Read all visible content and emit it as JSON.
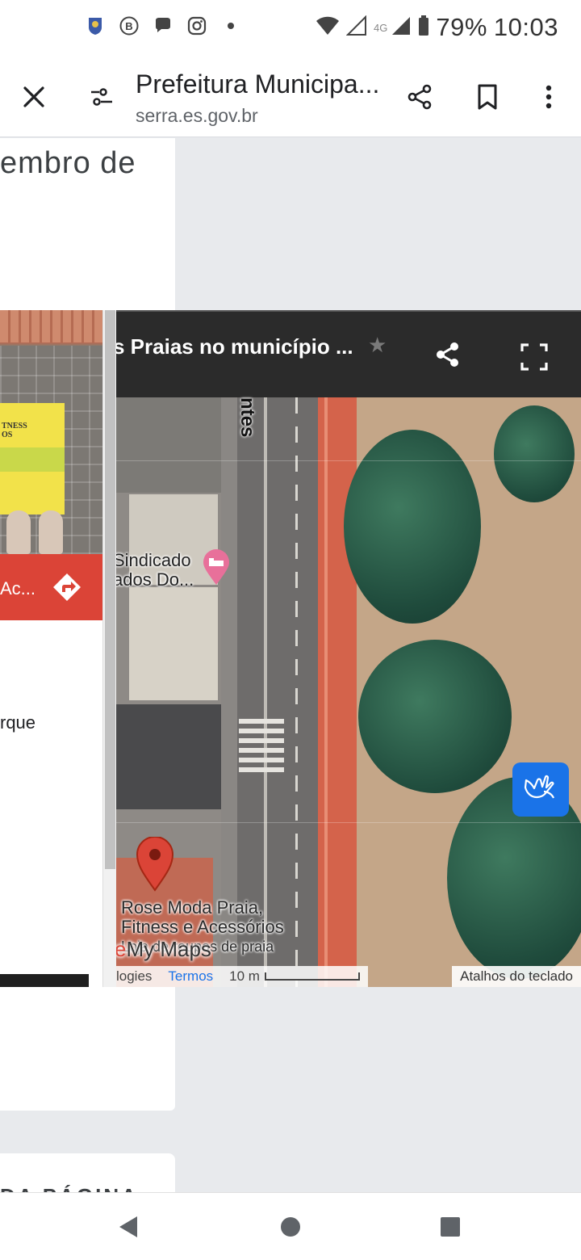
{
  "status_bar": {
    "battery": "79%",
    "time": "10:03",
    "network": "4G",
    "icons": [
      "app-badge-icon",
      "b-circle-icon",
      "chat-bubble-icon",
      "instagram-icon",
      "dot-icon",
      "wifi-icon",
      "signal-empty-icon",
      "signal-full-icon",
      "battery-icon"
    ]
  },
  "toolbar": {
    "title": "Prefeitura Municipa...",
    "url": "serra.es.gov.br"
  },
  "page": {
    "snippet_top": "embro de",
    "address_fragment": "rque",
    "heading_fragment": "DA PÁGINA"
  },
  "left_panel": {
    "banner_text": "TNESS\nOS",
    "route_label": "Ac..."
  },
  "map": {
    "title": "s Praias no município ...",
    "street_label": "ntes",
    "poi": "Sindicado\nados Do...",
    "marker_name_1": "Rose Moda Praia,",
    "marker_name_2": "Fitness e Acessórios",
    "marker_category": "Loja de roupas de praia",
    "logo_accent": "e",
    "logo_text": "My Maps",
    "attribution": "logies",
    "terms": "Termos",
    "scale": "10 m",
    "keyboard_shortcuts": "Atalhos do teclado",
    "colors": {
      "header": "#2b2b2b",
      "marker": "#db4437",
      "poi_pin": "#e8709a",
      "a11y_button": "#1a73e8"
    }
  }
}
